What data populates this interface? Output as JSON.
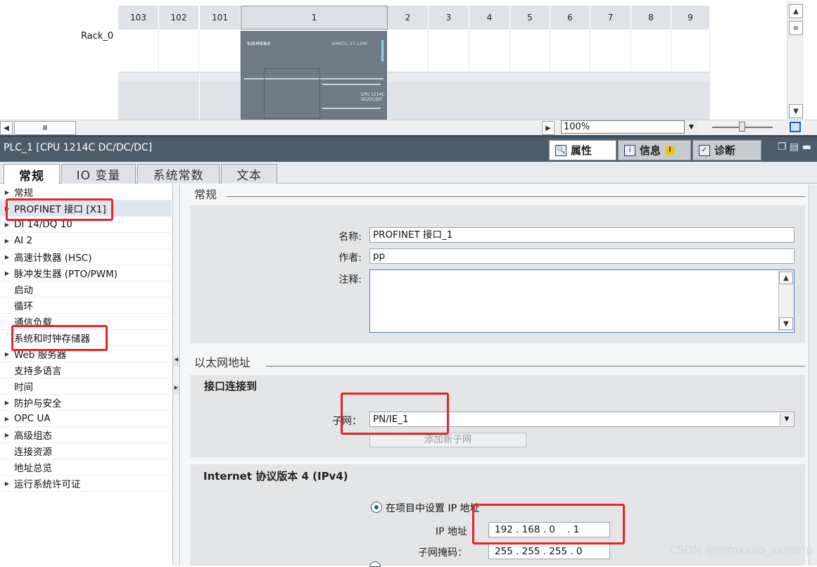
{
  "device_view": {
    "rack_label": "Rack_0",
    "slots": [
      "103",
      "102",
      "101",
      "1",
      "2",
      "3",
      "4",
      "5",
      "6",
      "7",
      "8",
      "9"
    ],
    "cpu": {
      "brand": "SIEMENS",
      "model": "SIMATIC S7-1200",
      "name_line1": "CPU 1214C",
      "name_line2": "DC/DC/DC"
    },
    "zoom": "100%"
  },
  "inspector": {
    "title": "PLC_1 [CPU 1214C DC/DC/DC]",
    "tabs": [
      {
        "label": "属性",
        "icon": "properties-icon"
      },
      {
        "label": "信息",
        "icon": "info-icon"
      },
      {
        "label": "诊断",
        "icon": "diagnostics-icon"
      }
    ],
    "subtabs": [
      "常规",
      "IO 变量",
      "系统常数",
      "文本"
    ]
  },
  "nav": {
    "items": [
      {
        "label": "常规",
        "caret": true
      },
      {
        "label": "PROFINET 接口 [X1]",
        "caret": true,
        "selected": true
      },
      {
        "label": "DI 14/DQ 10",
        "caret": true
      },
      {
        "label": "AI 2",
        "caret": true
      },
      {
        "label": "高速计数器 (HSC)",
        "caret": true
      },
      {
        "label": "脉冲发生器 (PTO/PWM)",
        "caret": true
      },
      {
        "label": "启动",
        "caret": false
      },
      {
        "label": "循环",
        "caret": false
      },
      {
        "label": "通信负载",
        "caret": false
      },
      {
        "label": "系统和时钟存储器",
        "caret": false
      },
      {
        "label": "Web 服务器",
        "caret": true
      },
      {
        "label": "支持多语言",
        "caret": false
      },
      {
        "label": "时间",
        "caret": false
      },
      {
        "label": "防护与安全",
        "caret": true
      },
      {
        "label": "OPC UA",
        "caret": true
      },
      {
        "label": "高级组态",
        "caret": true
      },
      {
        "label": "连接资源",
        "caret": false
      },
      {
        "label": "地址总览",
        "caret": false
      },
      {
        "label": "运行系统许可证",
        "caret": true
      }
    ]
  },
  "general": {
    "section": "常规",
    "name_label": "名称:",
    "name_value": "PROFINET 接口_1",
    "author_label": "作者:",
    "author_value": "pp",
    "comment_label": "注释:",
    "comment_value": ""
  },
  "ethernet": {
    "section": "以太网地址",
    "connect_title": "接口连接到",
    "subnet_label": "子网：",
    "subnet_value": "PN/IE_1",
    "add_subnet_button": "添加新子网",
    "ipv4_title": "Internet 协议版本 4 (IPv4)",
    "radio_set_ip": "在项目中设置 IP 地址",
    "ip_label": "IP 地址",
    "ip_value": "192 . 168 . 0    . 1",
    "mask_label": "子网掩码：",
    "mask_value": "255 . 255 . 255 . 0"
  },
  "watermark": "CSDN @mmxxoo_xxmmp",
  "colors": {
    "highlight": "#e8232a",
    "title_bar": "#4b5d6b",
    "accent": "#1f5fb0"
  }
}
